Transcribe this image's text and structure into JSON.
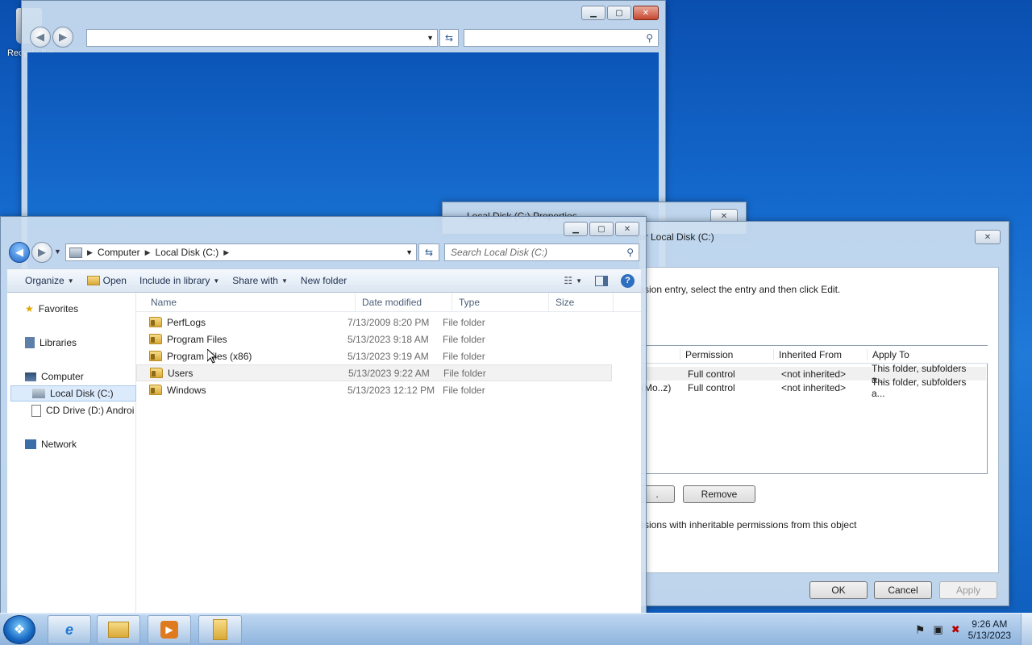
{
  "desktop": {
    "recycle_bin": "Recycle Bin"
  },
  "back_explorer": {
    "address": "",
    "search_placeholder": ""
  },
  "properties": {
    "title": "Local Disk (C:) Properties"
  },
  "advanced": {
    "title": "or Local Disk (C:)",
    "hint": "ssion entry, select the entry and then click Edit.",
    "columns": [
      "Permission",
      "Inherited From",
      "Apply To"
    ],
    "rows": [
      {
        "principal": "",
        "permission": "Full control",
        "inherited": "<not inherited>",
        "apply": "This folder, subfolders a..."
      },
      {
        "principal": "(Mo..z)",
        "permission": "Full control",
        "inherited": "<not inherited>",
        "apply": "This folder, subfolders a..."
      }
    ],
    "edit_btn": ".",
    "remove_btn": "Remove",
    "replace_text": "ssions with inheritable permissions from this object",
    "ok": "OK",
    "cancel": "Cancel",
    "apply": "Apply"
  },
  "explorer": {
    "breadcrumb": [
      "Computer",
      "Local Disk (C:)"
    ],
    "search_placeholder": "Search Local Disk (C:)",
    "commands": {
      "organize": "Organize",
      "open": "Open",
      "include": "Include in library",
      "share": "Share with",
      "new_folder": "New folder"
    },
    "nav": {
      "favorites": "Favorites",
      "libraries": "Libraries",
      "computer": "Computer",
      "local_disk": "Local Disk (C:)",
      "cd_drive": "CD Drive (D:) Androi",
      "network": "Network"
    },
    "columns": {
      "name": "Name",
      "date": "Date modified",
      "type": "Type",
      "size": "Size"
    },
    "files": [
      {
        "name": "PerfLogs",
        "date": "7/13/2009 8:20 PM",
        "type": "File folder"
      },
      {
        "name": "Program Files",
        "date": "5/13/2023 9:18 AM",
        "type": "File folder"
      },
      {
        "name": "Program Files (x86)",
        "date": "5/13/2023 9:19 AM",
        "type": "File folder"
      },
      {
        "name": "Users",
        "date": "5/13/2023 9:22 AM",
        "type": "File folder"
      },
      {
        "name": "Windows",
        "date": "5/13/2023 12:12 PM",
        "type": "File folder"
      }
    ]
  },
  "taskbar": {
    "time": "9:26 AM",
    "date": "5/13/2023"
  }
}
